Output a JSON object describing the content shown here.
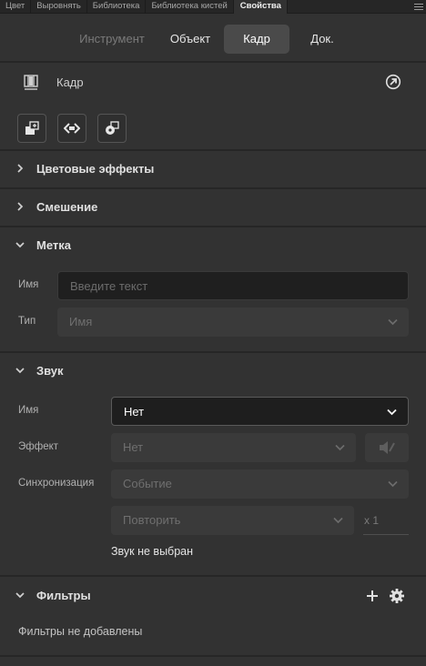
{
  "panel_tabs": [
    "Цвет",
    "Выровнять",
    "Библиотека",
    "Библиотека кистей",
    "Свойства"
  ],
  "context_tabs": {
    "tool": "Инструмент",
    "object": "Объект",
    "frame": "Кадр",
    "doc": "Док."
  },
  "frame_header": {
    "label": "Кадр"
  },
  "sections": {
    "color_effects": "Цветовые эффекты",
    "blending": "Смешение",
    "label": "Метка",
    "sound": "Звук",
    "filters": "Фильтры"
  },
  "label_section": {
    "name_label": "Имя",
    "name_placeholder": "Введите текст",
    "type_label": "Тип",
    "type_value": "Имя"
  },
  "sound_section": {
    "name_label": "Имя",
    "name_value": "Нет",
    "effect_label": "Эффект",
    "effect_value": "Нет",
    "sync_label": "Синхронизация",
    "sync_value": "Событие",
    "repeat_value": "Повторить",
    "repeat_count": "x 1",
    "status": "Звук не выбран"
  },
  "filters_section": {
    "status": "Фильтры не добавлены"
  },
  "colors": {
    "bg": "#323232",
    "strip": "#262626",
    "active_tab": "#4a4a4a"
  }
}
